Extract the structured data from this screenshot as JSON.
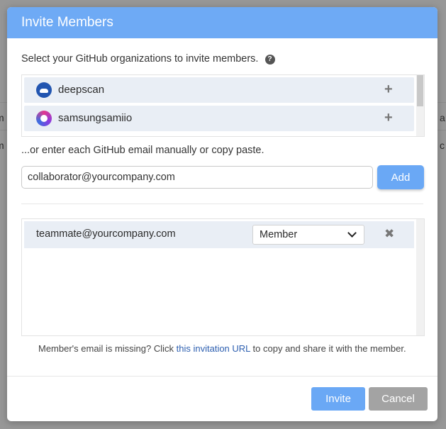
{
  "background": {
    "left_fragments": [
      "m",
      "m"
    ],
    "right_fragments": [
      "a",
      "c"
    ]
  },
  "dialog": {
    "title": "Invite Members",
    "org_prompt": "Select your GitHub organizations to invite members.",
    "help_icon": "question-circle-icon",
    "organizations": [
      {
        "name": "deepscan",
        "avatar": "deepscan-avatar",
        "action_icon": "plus-icon",
        "action_glyph": "+"
      },
      {
        "name": "samsungsamiio",
        "avatar": "samsungsamiio-avatar",
        "action_icon": "plus-icon",
        "action_glyph": "+"
      }
    ],
    "manual_prompt": "...or enter each GitHub email manually or copy paste.",
    "email_input": {
      "value": "collaborator@yourcompany.com",
      "placeholder": ""
    },
    "add_label": "Add",
    "members": [
      {
        "email": "teammate@yourcompany.com",
        "role": "Member",
        "remove_glyph": "✖"
      }
    ],
    "missing_note": {
      "before": "Member's email is missing? Click ",
      "link": "this invitation URL",
      "after": " to copy and share it with the member."
    },
    "invite_label": "Invite",
    "cancel_label": "Cancel"
  },
  "colors": {
    "header": "#6eaaf5",
    "primary_button": "#6aa8f5",
    "cancel_button": "#a3a3a3",
    "row_background": "#e9eef5",
    "link": "#2d5fb0"
  }
}
